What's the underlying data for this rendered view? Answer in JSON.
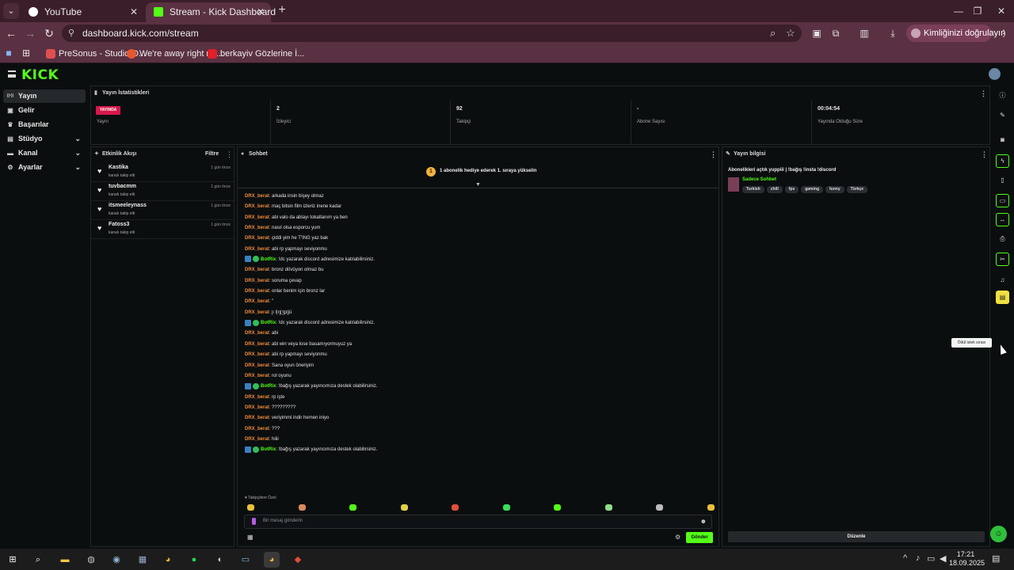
{
  "browser": {
    "tabs": [
      {
        "title": "YouTube",
        "active": false,
        "favicon_color": "#ffffff"
      },
      {
        "title": "Stream - Kick Dashboard",
        "active": true,
        "favicon_color": "#53fc18"
      }
    ],
    "url": "dashboard.kick.com/stream",
    "profile_pill": "Kimliğinizi doğrulayın",
    "bookmarks": [
      {
        "label": "PreSonus - Studio O...",
        "color": "#e05050"
      },
      {
        "label": "We're away right no...",
        "color": "#e8582e"
      },
      {
        "label": "berkayiv Gözlerine İ...",
        "color": "#e0202a"
      }
    ]
  },
  "kick": {
    "logo": "KICK",
    "sidebar": [
      {
        "label": "Yayın",
        "icon": "broadcast-icon",
        "glyph": "((•))",
        "active": true,
        "chevron": false
      },
      {
        "label": "Gelir",
        "icon": "money-icon",
        "glyph": "▣",
        "active": false,
        "chevron": false
      },
      {
        "label": "Başarılar",
        "icon": "trophy-icon",
        "glyph": "♛",
        "active": false,
        "chevron": false
      },
      {
        "label": "Stüdyo",
        "icon": "studio-icon",
        "glyph": "▤",
        "active": false,
        "chevron": true
      },
      {
        "label": "Kanal",
        "icon": "channel-icon",
        "glyph": "▬",
        "active": false,
        "chevron": true
      },
      {
        "label": "Ayarlar",
        "icon": "settings-icon",
        "glyph": "⚙",
        "active": false,
        "chevron": true
      }
    ],
    "stats": {
      "title": "Yayın İstatistikleri",
      "live_badge": "YAYINDA",
      "cells": [
        {
          "value": "",
          "label": "Yayın"
        },
        {
          "value": "2",
          "label": "İzleyici"
        },
        {
          "value": "92",
          "label": "Takipçi"
        },
        {
          "value": "-",
          "label": "Abone Sayısı"
        },
        {
          "value": "00:04:54",
          "label": "Yayında Olduğu Süre"
        }
      ]
    },
    "activity": {
      "title": "Etkinlik Akışı",
      "filter": "Filtre",
      "items": [
        {
          "name": "Kastika",
          "action": "kanalı takip etti",
          "time": "1 gün önce"
        },
        {
          "name": "tuvbacmm",
          "action": "kanalı takip etti",
          "time": "1 gün önce"
        },
        {
          "name": "itsmeeleynass",
          "action": "kanalı takip etti",
          "time": "1 gün önce"
        },
        {
          "name": "Fatoss3",
          "action": "kanalı takip etti",
          "time": "1 gün önce"
        }
      ]
    },
    "chat": {
      "title": "Sohbet",
      "pinned_badge": "1",
      "pinned_text": "1 abonelik hediye ederek 1. sıraya yükselin",
      "messages": [
        {
          "user": "DRX_berat",
          "text": "arkada insin bişey olmaz",
          "bot": false
        },
        {
          "user": "DRX_berat",
          "text": "maç bitsin film izleriz inene kadar",
          "bot": false
        },
        {
          "user": "DRX_berat",
          "text": "abi valo da ablayı tokatlanım ya ben",
          "bot": false
        },
        {
          "user": "DRX_berat",
          "text": "nasıl olsa esporcu yum",
          "bot": false
        },
        {
          "user": "DRX_berat",
          "text": "çiddi yim he T'ING yaz bak",
          "bot": false
        },
        {
          "user": "DRX_berat",
          "text": "abi rp yapmayı seviyonmu",
          "bot": false
        },
        {
          "user": "BotRix",
          "text": "!dc yazarak discord adresimize katılabilirsiniz.",
          "bot": true
        },
        {
          "user": "DRX_berat",
          "text": "bronz dövüyon olmaz bu",
          "bot": false
        },
        {
          "user": "DRX_berat",
          "text": "soruma çevap",
          "bot": false
        },
        {
          "user": "DRX_berat",
          "text": "onlar benim için bronz lar",
          "bot": false
        },
        {
          "user": "DRX_berat",
          "text": "\"",
          "bot": false
        },
        {
          "user": "DRX_berat",
          "text": "jı l|ŋ|ʒp|jü",
          "bot": false
        },
        {
          "user": "BotRix",
          "text": "!dc yazarak discord adresimize katılabilirsiniz.",
          "bot": true
        },
        {
          "user": "DRX_berat",
          "text": "abi",
          "bot": false
        },
        {
          "user": "DRX_berat",
          "text": "abi win veya lose basamıyormuyuz ya",
          "bot": false
        },
        {
          "user": "DRX_berat",
          "text": "abi rp yapmayı seviyonmu",
          "bot": false
        },
        {
          "user": "DRX_berat",
          "text": "Sana oyun öneriyim",
          "bot": false
        },
        {
          "user": "DRX_berat",
          "text": "rol oyunu",
          "bot": false
        },
        {
          "user": "BotRix",
          "text": "!bağış yazarak yayıncımıza destek olabilirsiniz.",
          "bot": true
        },
        {
          "user": "DRX_berat",
          "text": "rp işte",
          "bot": false
        },
        {
          "user": "DRX_berat",
          "text": "?????????",
          "bot": false
        },
        {
          "user": "DRX_berat",
          "text": "veriyimmi indir hemen iniyo",
          "bot": false
        },
        {
          "user": "DRX_berat",
          "text": "???",
          "bot": false
        },
        {
          "user": "DRX_berat",
          "text": "hiiii",
          "bot": false
        },
        {
          "user": "BotRix",
          "text": "!bağış yazarak yayıncımıza destek olabilirsiniz.",
          "bot": true
        }
      ],
      "subscribers_label": "♥ Takipçilere Özel",
      "emote_colors": [
        "#e9c13a",
        "#d98a5e",
        "#53fc18",
        "#e0d04a",
        "#e0503a",
        "#3adf5a",
        "#53fc18",
        "#8fdf8a",
        "#bbbbbb",
        "#e9c13a"
      ],
      "input_placeholder": "Bir mesaj gönderin",
      "send_label": "Gönder"
    },
    "stream_info": {
      "title": "Yayın bilgisi",
      "stream_title": "Abonelikleri açtık yuppiii | !bağış !insta !discord",
      "category": "Sadece Sohbet",
      "tags": [
        "Turkish",
        "chill",
        "fps",
        "gaming",
        "funny",
        "Türkçe"
      ],
      "edit_label": "Düzenle"
    },
    "rail_tooltip": "Ödül istek sırası"
  },
  "taskbar": {
    "time": "17:21",
    "date": "18.09.2025"
  }
}
